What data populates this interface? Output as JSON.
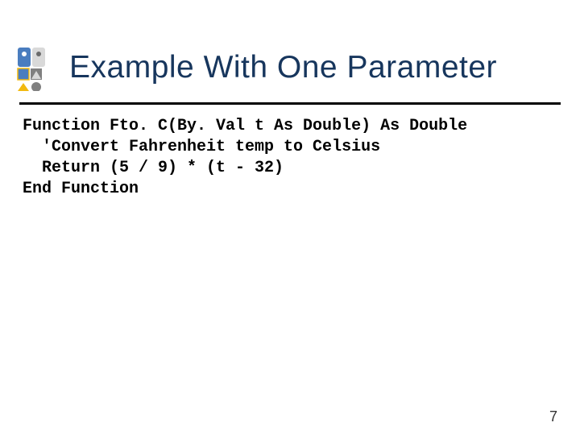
{
  "title": "Example With One Parameter",
  "code": {
    "line1": "Function Fto. C(By. Val t As Double) As Double",
    "line2": "  'Convert Fahrenheit temp to Celsius",
    "line3": "  Return (5 / 9) * (t - 32)",
    "line4": "End Function"
  },
  "page_number": "7"
}
